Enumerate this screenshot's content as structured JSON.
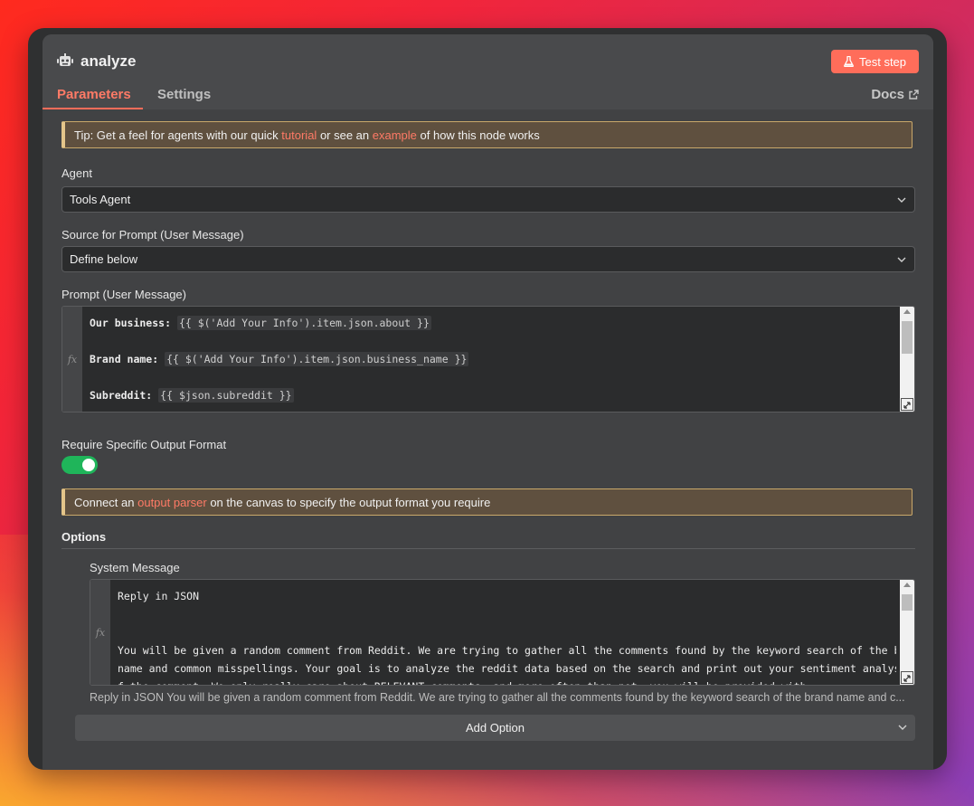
{
  "header": {
    "title": "analyze",
    "test_button": "Test step",
    "icon": "robot-icon"
  },
  "tabs": {
    "parameters": "Parameters",
    "settings": "Settings",
    "docs": "Docs"
  },
  "tip": {
    "prefix": "Tip: Get a feel for agents with our quick ",
    "link1": "tutorial",
    "middle": " or see an ",
    "link2": "example",
    "suffix": " of how this node works"
  },
  "agent": {
    "label": "Agent",
    "value": "Tools Agent"
  },
  "source": {
    "label": "Source for Prompt (User Message)",
    "value": "Define below"
  },
  "prompt": {
    "label": "Prompt (User Message)",
    "fx": "fx",
    "lines": [
      {
        "key": "Our business: ",
        "expr": "{{ $('Add Your Info').item.json.about }}"
      },
      {
        "key": "",
        "expr": ""
      },
      {
        "key": "Brand name: ",
        "expr": "{{ $('Add Your Info').item.json.business_name }}"
      },
      {
        "key": "",
        "expr": ""
      },
      {
        "key": "Subreddit:  ",
        "expr": "{{ $json.subreddit }}"
      }
    ]
  },
  "output_format": {
    "label": "Require Specific Output Format",
    "enabled": true
  },
  "parser_notice": {
    "prefix": "Connect an ",
    "link": "output parser",
    "suffix": " on the canvas to specify the output format you require"
  },
  "options": {
    "heading": "Options",
    "system_message": {
      "label": "System Message",
      "fx": "fx",
      "lines": [
        "Reply in JSON",
        "",
        "",
        "You will be given a random comment from Reddit. We are trying to gather all the comments found by the keyword search of the brand",
        "name and common misspellings. Your goal is to analyze the reddit data based on the search and print out your sentiment analysis o",
        "f the comment. We only really care about RELEVANT comments, and more often than not, you will be provided with"
      ],
      "preview": "Reply in JSON You will be given a random comment from Reddit. We are trying to gather all the comments found by the keyword search of the brand name and c..."
    },
    "add_option": "Add Option"
  }
}
